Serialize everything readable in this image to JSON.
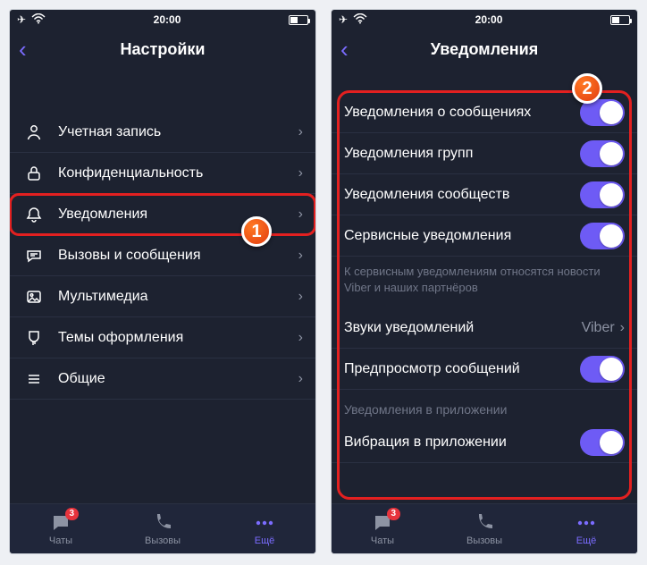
{
  "status": {
    "time": "20:00"
  },
  "screen1": {
    "title": "Настройки",
    "items": [
      {
        "label": "Учетная запись"
      },
      {
        "label": "Конфиденциальность"
      },
      {
        "label": "Уведомления"
      },
      {
        "label": "Вызовы и сообщения"
      },
      {
        "label": "Мультимедиа"
      },
      {
        "label": "Темы оформления"
      },
      {
        "label": "Общие"
      }
    ]
  },
  "screen2": {
    "title": "Уведомления",
    "toggles": [
      {
        "label": "Уведомления о сообщениях"
      },
      {
        "label": "Уведомления групп"
      },
      {
        "label": "Уведомления сообществ"
      },
      {
        "label": "Сервисные уведомления"
      }
    ],
    "footnote": "К сервисным уведомлениям относятся новости Viber и наших партнёров",
    "sound": {
      "label": "Звуки уведомлений",
      "value": "Viber"
    },
    "preview": {
      "label": "Предпросмотр сообщений"
    },
    "section": "Уведомления в приложении",
    "vibrate": {
      "label": "Вибрация в приложении"
    }
  },
  "tabs": {
    "chats": "Чаты",
    "calls": "Вызовы",
    "more": "Ещё",
    "badge": "3"
  },
  "markers": {
    "one": "1",
    "two": "2"
  }
}
